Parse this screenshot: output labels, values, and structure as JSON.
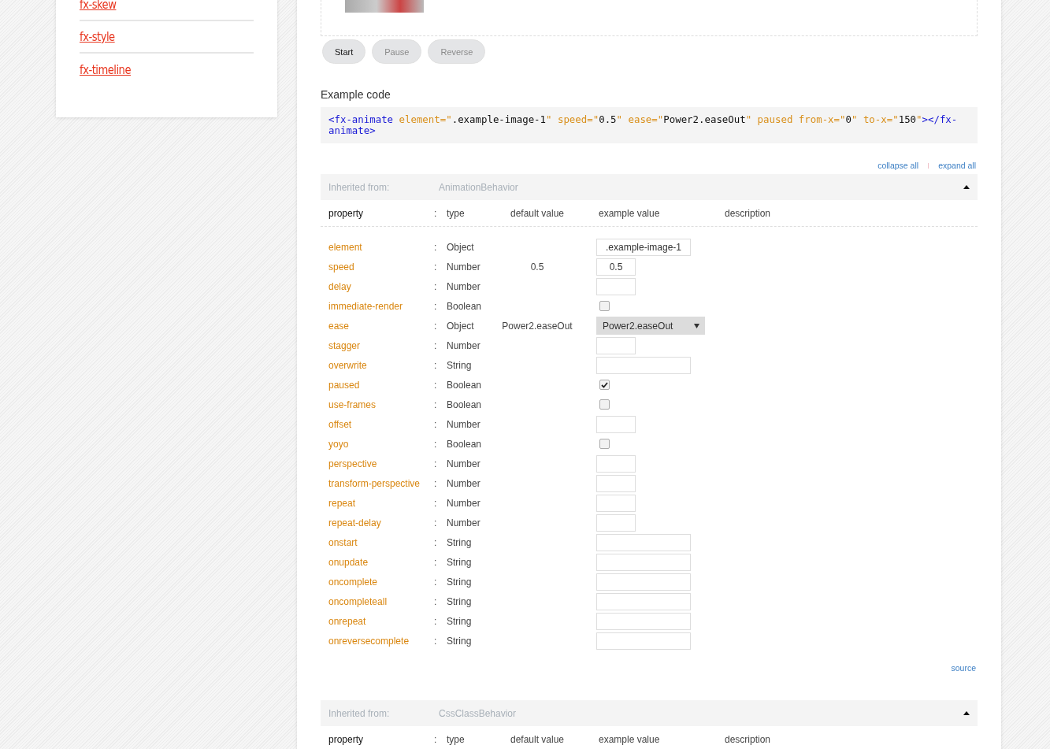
{
  "sidebar": {
    "links": [
      "fx-skew",
      "fx-style",
      "fx-timeline"
    ]
  },
  "demo": {
    "buttons": [
      {
        "label": "Start",
        "disabled": false
      },
      {
        "label": "Pause",
        "disabled": true
      },
      {
        "label": "Reverse",
        "disabled": true
      }
    ]
  },
  "example_code": {
    "title": "Example code",
    "tokens": [
      {
        "kind": "tag",
        "text": "<fx-animate"
      },
      {
        "kind": "attr",
        "text": " element=\""
      },
      {
        "kind": "value",
        "text": ".example-image-1"
      },
      {
        "kind": "attr",
        "text": "\" speed=\""
      },
      {
        "kind": "value",
        "text": "0.5"
      },
      {
        "kind": "attr",
        "text": "\" ease=\""
      },
      {
        "kind": "value",
        "text": "Power2.easeOut"
      },
      {
        "kind": "attr",
        "text": "\" paused from-x=\""
      },
      {
        "kind": "value",
        "text": "0"
      },
      {
        "kind": "attr",
        "text": "\" to-x=\""
      },
      {
        "kind": "value",
        "text": "150"
      },
      {
        "kind": "attr",
        "text": "\""
      },
      {
        "kind": "tag",
        "text": "></fx-animate>"
      }
    ]
  },
  "toolbar": {
    "collapse": "collapse all",
    "expand": "expand all"
  },
  "sections": [
    {
      "inherited_label": "Inherited from:",
      "behavior": "AnimationBehavior",
      "expanded": true,
      "columns": {
        "property": "property",
        "separator": ":",
        "type": "type",
        "default": "default value",
        "example": "example value",
        "description": "description"
      },
      "rows": [
        {
          "name": "element",
          "separator": ":",
          "type": "Object",
          "kind": "text",
          "value": ".example-image-1"
        },
        {
          "name": "speed",
          "separator": ":",
          "type": "Number",
          "default": "0.5",
          "kind": "number",
          "value": "0.5"
        },
        {
          "name": "delay",
          "separator": ":",
          "type": "Number",
          "kind": "number"
        },
        {
          "name": "immediate-render",
          "separator": ":",
          "type": "Boolean",
          "kind": "checkbox",
          "checked": false
        },
        {
          "name": "ease",
          "separator": ":",
          "type": "Object",
          "default": "Power2.easeOut",
          "kind": "select",
          "value": "Power2.easeOut"
        },
        {
          "name": "stagger",
          "separator": ":",
          "type": "Number",
          "kind": "number"
        },
        {
          "name": "overwrite",
          "separator": ":",
          "type": "String",
          "kind": "text"
        },
        {
          "name": "paused",
          "separator": ":",
          "type": "Boolean",
          "kind": "checkbox",
          "checked": true
        },
        {
          "name": "use-frames",
          "separator": ":",
          "type": "Boolean",
          "kind": "checkbox",
          "checked": false
        },
        {
          "name": "offset",
          "separator": ":",
          "type": "Number",
          "kind": "number"
        },
        {
          "name": "yoyo",
          "separator": ":",
          "type": "Boolean",
          "kind": "checkbox",
          "checked": false
        },
        {
          "name": "perspective",
          "separator": ":",
          "type": "Number",
          "kind": "number"
        },
        {
          "name": "transform-perspective",
          "separator": ":",
          "type": "Number",
          "kind": "number"
        },
        {
          "name": "repeat",
          "separator": ":",
          "type": "Number",
          "kind": "number"
        },
        {
          "name": "repeat-delay",
          "separator": ":",
          "type": "Number",
          "kind": "number"
        },
        {
          "name": "onstart",
          "separator": ":",
          "type": "String",
          "kind": "text"
        },
        {
          "name": "onupdate",
          "separator": ":",
          "type": "String",
          "kind": "text"
        },
        {
          "name": "oncomplete",
          "separator": ":",
          "type": "String",
          "kind": "text"
        },
        {
          "name": "oncompleteall",
          "separator": ":",
          "type": "String",
          "kind": "text"
        },
        {
          "name": "onrepeat",
          "separator": ":",
          "type": "String",
          "kind": "text"
        },
        {
          "name": "onreversecomplete",
          "separator": ":",
          "type": "String",
          "kind": "text"
        }
      ],
      "source": "source"
    },
    {
      "inherited_label": "Inherited from:",
      "behavior": "CssClassBehavior",
      "expanded": true,
      "columns": {
        "property": "property",
        "separator": ":",
        "type": "type",
        "default": "default value",
        "example": "example value",
        "description": "description"
      }
    }
  ]
}
